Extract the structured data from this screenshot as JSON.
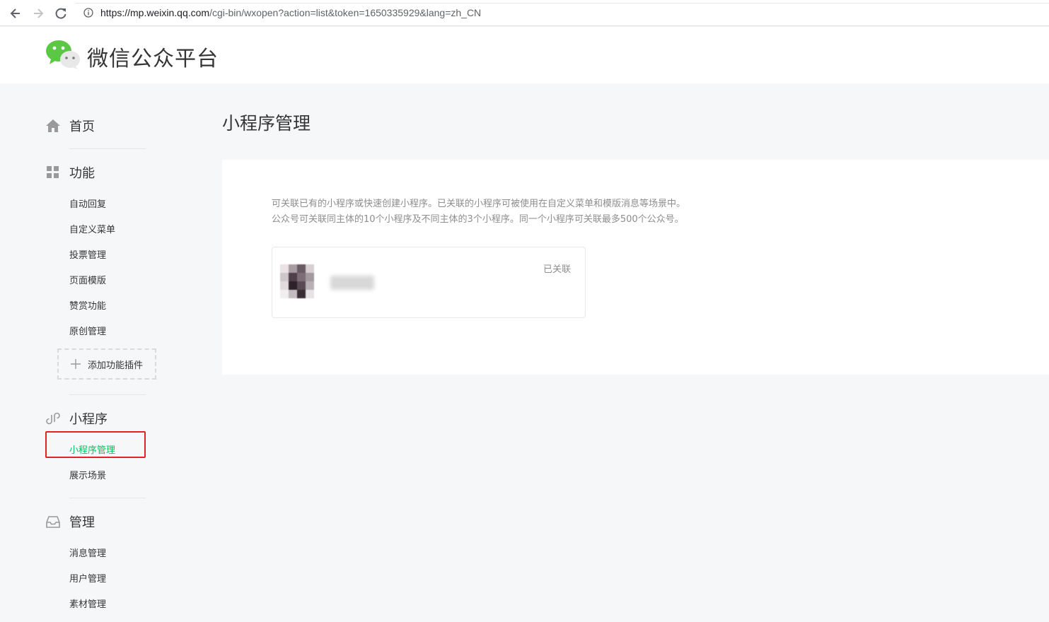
{
  "browser": {
    "url_host": "https://mp.weixin.qq.com",
    "url_path": "/cgi-bin/wxopen?action=list&token=1650335929&lang=zh_CN",
    "icons": [
      "back-arrow-icon",
      "forward-arrow-icon",
      "reload-icon",
      "info-icon"
    ]
  },
  "header": {
    "app_title": "微信公众平台",
    "logo_icon": "wechat-logo-icon"
  },
  "sidebar": {
    "home": {
      "label": "首页",
      "icon": "home-icon"
    },
    "functions": {
      "label": "功能",
      "icon": "grid-icon",
      "items": [
        "自动回复",
        "自定义菜单",
        "投票管理",
        "页面模版",
        "赞赏功能",
        "原创管理"
      ],
      "add_plugin": "添加功能插件"
    },
    "miniprogram": {
      "label": "小程序",
      "icon": "link-icon",
      "items": [
        "小程序管理",
        "展示场景"
      ],
      "active_item": "小程序管理"
    },
    "manage": {
      "label": "管理",
      "icon": "inbox-icon",
      "items": [
        "消息管理",
        "用户管理",
        "素材管理"
      ]
    }
  },
  "main": {
    "title": "小程序管理",
    "description_line1": "可关联已有的小程序或快速创建小程序。已关联的小程序可被使用在自定义菜单和模版消息等场景中。",
    "description_line2": "公众号可关联同主体的10个小程序及不同主体的3个小程序。同一个小程序可关联最多500个公众号。",
    "linked_card": {
      "status": "已关联"
    }
  },
  "colors": {
    "accent_green": "#07c160",
    "highlight_red": "#e02424",
    "page_bg": "#f6f7f9"
  }
}
